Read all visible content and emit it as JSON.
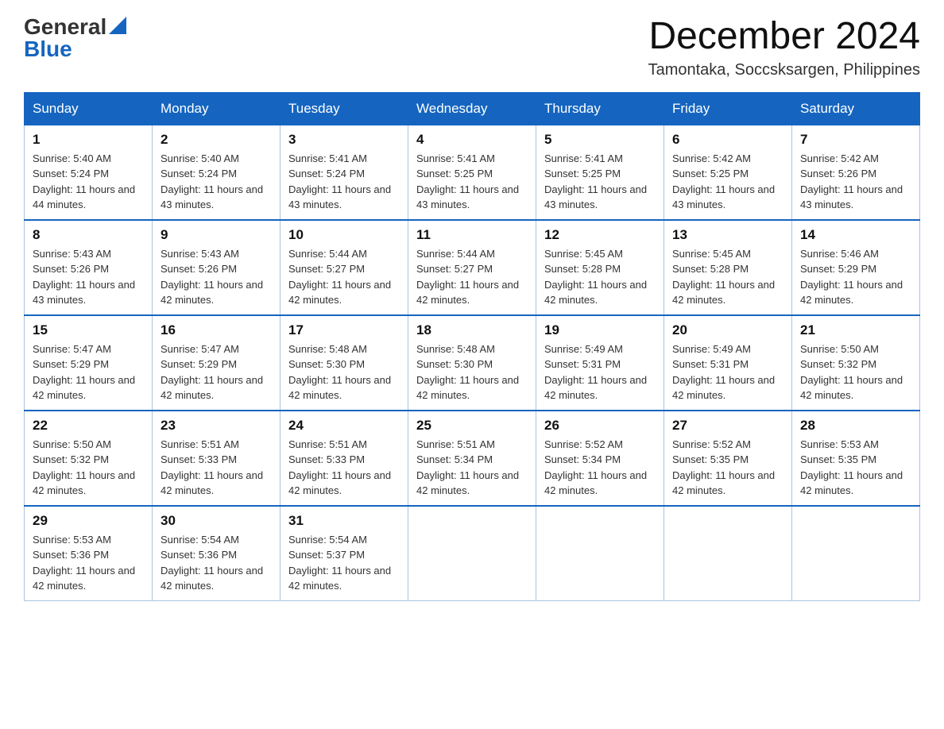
{
  "header": {
    "logo_general": "General",
    "logo_blue": "Blue",
    "month_title": "December 2024",
    "location": "Tamontaka, Soccsksargen, Philippines"
  },
  "days_of_week": [
    "Sunday",
    "Monday",
    "Tuesday",
    "Wednesday",
    "Thursday",
    "Friday",
    "Saturday"
  ],
  "weeks": [
    [
      {
        "day": "1",
        "sunrise": "5:40 AM",
        "sunset": "5:24 PM",
        "daylight": "11 hours and 44 minutes."
      },
      {
        "day": "2",
        "sunrise": "5:40 AM",
        "sunset": "5:24 PM",
        "daylight": "11 hours and 43 minutes."
      },
      {
        "day": "3",
        "sunrise": "5:41 AM",
        "sunset": "5:24 PM",
        "daylight": "11 hours and 43 minutes."
      },
      {
        "day": "4",
        "sunrise": "5:41 AM",
        "sunset": "5:25 PM",
        "daylight": "11 hours and 43 minutes."
      },
      {
        "day": "5",
        "sunrise": "5:41 AM",
        "sunset": "5:25 PM",
        "daylight": "11 hours and 43 minutes."
      },
      {
        "day": "6",
        "sunrise": "5:42 AM",
        "sunset": "5:25 PM",
        "daylight": "11 hours and 43 minutes."
      },
      {
        "day": "7",
        "sunrise": "5:42 AM",
        "sunset": "5:26 PM",
        "daylight": "11 hours and 43 minutes."
      }
    ],
    [
      {
        "day": "8",
        "sunrise": "5:43 AM",
        "sunset": "5:26 PM",
        "daylight": "11 hours and 43 minutes."
      },
      {
        "day": "9",
        "sunrise": "5:43 AM",
        "sunset": "5:26 PM",
        "daylight": "11 hours and 42 minutes."
      },
      {
        "day": "10",
        "sunrise": "5:44 AM",
        "sunset": "5:27 PM",
        "daylight": "11 hours and 42 minutes."
      },
      {
        "day": "11",
        "sunrise": "5:44 AM",
        "sunset": "5:27 PM",
        "daylight": "11 hours and 42 minutes."
      },
      {
        "day": "12",
        "sunrise": "5:45 AM",
        "sunset": "5:28 PM",
        "daylight": "11 hours and 42 minutes."
      },
      {
        "day": "13",
        "sunrise": "5:45 AM",
        "sunset": "5:28 PM",
        "daylight": "11 hours and 42 minutes."
      },
      {
        "day": "14",
        "sunrise": "5:46 AM",
        "sunset": "5:29 PM",
        "daylight": "11 hours and 42 minutes."
      }
    ],
    [
      {
        "day": "15",
        "sunrise": "5:47 AM",
        "sunset": "5:29 PM",
        "daylight": "11 hours and 42 minutes."
      },
      {
        "day": "16",
        "sunrise": "5:47 AM",
        "sunset": "5:29 PM",
        "daylight": "11 hours and 42 minutes."
      },
      {
        "day": "17",
        "sunrise": "5:48 AM",
        "sunset": "5:30 PM",
        "daylight": "11 hours and 42 minutes."
      },
      {
        "day": "18",
        "sunrise": "5:48 AM",
        "sunset": "5:30 PM",
        "daylight": "11 hours and 42 minutes."
      },
      {
        "day": "19",
        "sunrise": "5:49 AM",
        "sunset": "5:31 PM",
        "daylight": "11 hours and 42 minutes."
      },
      {
        "day": "20",
        "sunrise": "5:49 AM",
        "sunset": "5:31 PM",
        "daylight": "11 hours and 42 minutes."
      },
      {
        "day": "21",
        "sunrise": "5:50 AM",
        "sunset": "5:32 PM",
        "daylight": "11 hours and 42 minutes."
      }
    ],
    [
      {
        "day": "22",
        "sunrise": "5:50 AM",
        "sunset": "5:32 PM",
        "daylight": "11 hours and 42 minutes."
      },
      {
        "day": "23",
        "sunrise": "5:51 AM",
        "sunset": "5:33 PM",
        "daylight": "11 hours and 42 minutes."
      },
      {
        "day": "24",
        "sunrise": "5:51 AM",
        "sunset": "5:33 PM",
        "daylight": "11 hours and 42 minutes."
      },
      {
        "day": "25",
        "sunrise": "5:51 AM",
        "sunset": "5:34 PM",
        "daylight": "11 hours and 42 minutes."
      },
      {
        "day": "26",
        "sunrise": "5:52 AM",
        "sunset": "5:34 PM",
        "daylight": "11 hours and 42 minutes."
      },
      {
        "day": "27",
        "sunrise": "5:52 AM",
        "sunset": "5:35 PM",
        "daylight": "11 hours and 42 minutes."
      },
      {
        "day": "28",
        "sunrise": "5:53 AM",
        "sunset": "5:35 PM",
        "daylight": "11 hours and 42 minutes."
      }
    ],
    [
      {
        "day": "29",
        "sunrise": "5:53 AM",
        "sunset": "5:36 PM",
        "daylight": "11 hours and 42 minutes."
      },
      {
        "day": "30",
        "sunrise": "5:54 AM",
        "sunset": "5:36 PM",
        "daylight": "11 hours and 42 minutes."
      },
      {
        "day": "31",
        "sunrise": "5:54 AM",
        "sunset": "5:37 PM",
        "daylight": "11 hours and 42 minutes."
      },
      null,
      null,
      null,
      null
    ]
  ]
}
